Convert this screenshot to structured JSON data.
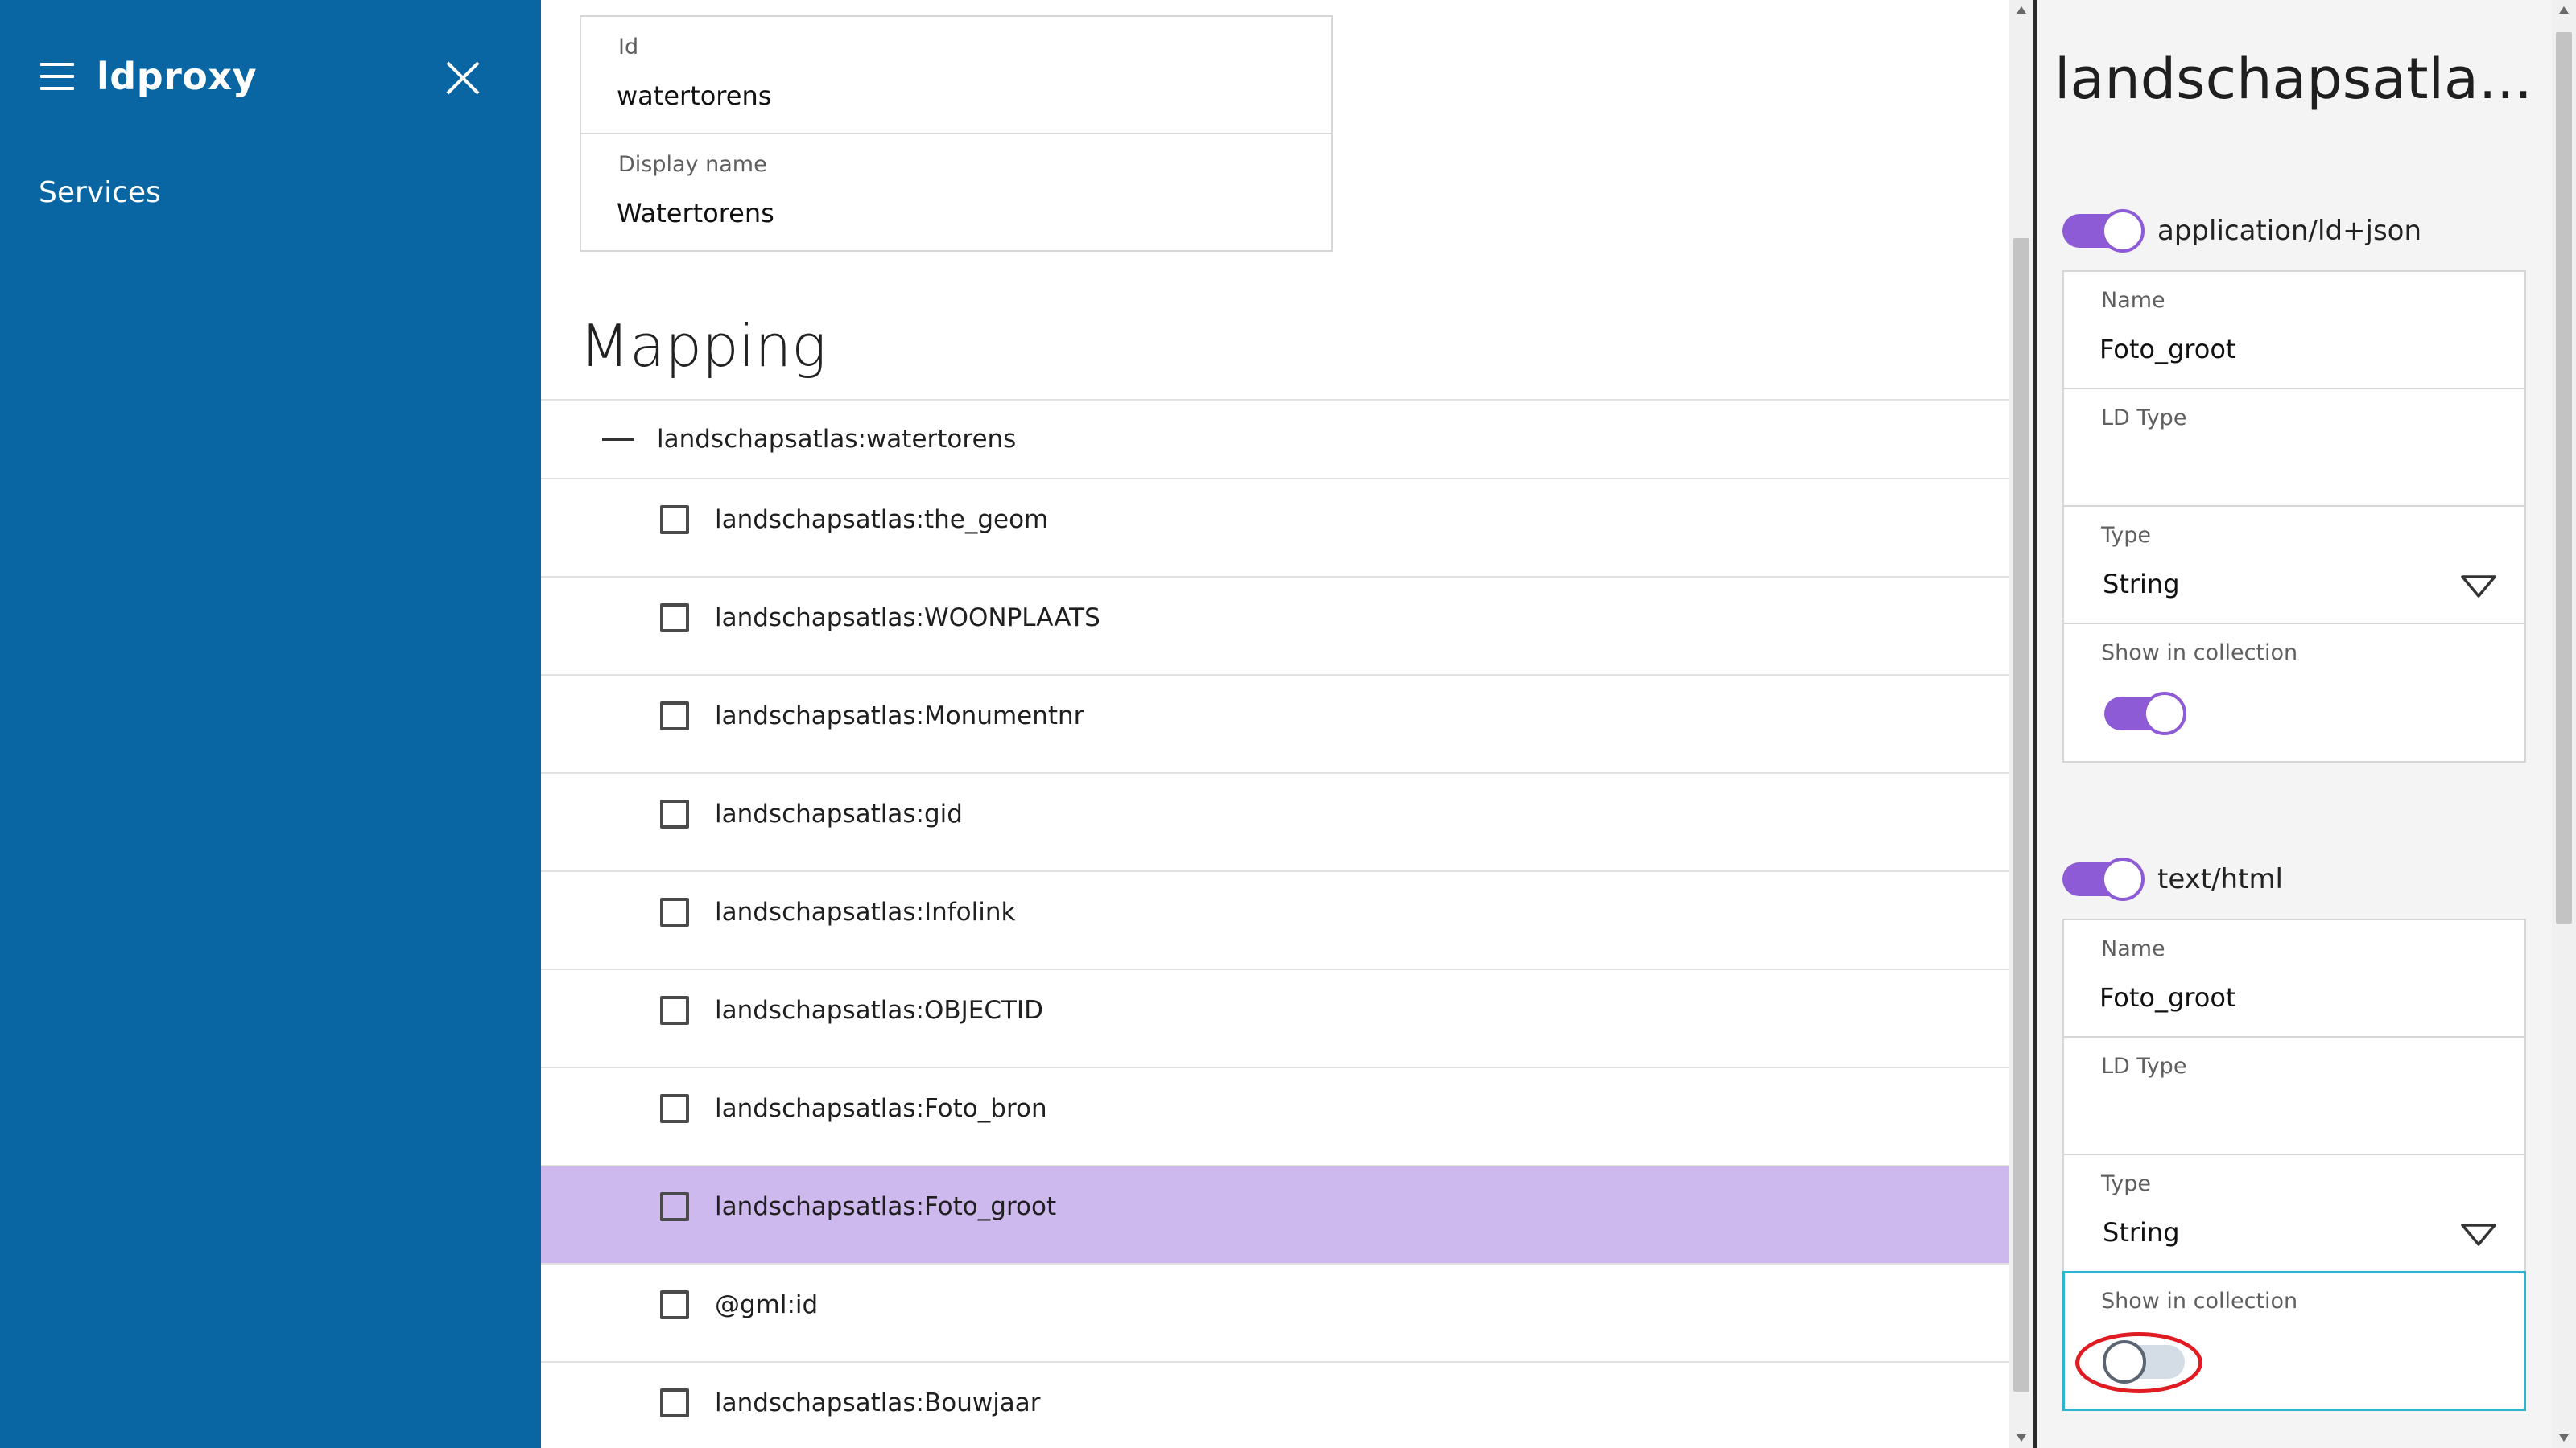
{
  "sidebar": {
    "app_title": "ldproxy",
    "nav": [
      {
        "label": "Services"
      }
    ]
  },
  "main": {
    "id_field": {
      "label": "Id",
      "value": "watertorens"
    },
    "display_name_field": {
      "label": "Display name",
      "value": "Watertorens"
    },
    "section_title": "Mapping",
    "tree": {
      "root": "landschapsatlas:watertorens",
      "items": [
        {
          "label": "landschapsatlas:the_geom"
        },
        {
          "label": "landschapsatlas:WOONPLAATS"
        },
        {
          "label": "landschapsatlas:Monumentnr"
        },
        {
          "label": "landschapsatlas:gid"
        },
        {
          "label": "landschapsatlas:Infolink"
        },
        {
          "label": "landschapsatlas:OBJECTID"
        },
        {
          "label": "landschapsatlas:Foto_bron"
        },
        {
          "label": "landschapsatlas:Foto_groot",
          "selected": true
        },
        {
          "label": "@gml:id"
        },
        {
          "label": "landschapsatlas:Bouwjaar"
        }
      ]
    }
  },
  "panel": {
    "title": "landschapsatla...",
    "formats": [
      {
        "mime": "application/ld+json",
        "enabled": true,
        "name_label": "Name",
        "name_value": "Foto_groot",
        "ld_type_label": "LD Type",
        "ld_type_value": "",
        "type_label": "Type",
        "type_value": "String",
        "show_label": "Show in collection",
        "show_in_collection": true
      },
      {
        "mime": "text/html",
        "enabled": true,
        "name_label": "Name",
        "name_value": "Foto_groot",
        "ld_type_label": "LD Type",
        "ld_type_value": "",
        "type_label": "Type",
        "type_value": "String",
        "show_label": "Show in collection",
        "show_in_collection": false
      }
    ]
  },
  "colors": {
    "sidebar_bg": "#0a65a3",
    "selected_row": "#cdb9ed",
    "toggle_on": "#8e5bd6",
    "focus_outline": "#2eb4cf",
    "highlight_ring": "#e11b22"
  }
}
